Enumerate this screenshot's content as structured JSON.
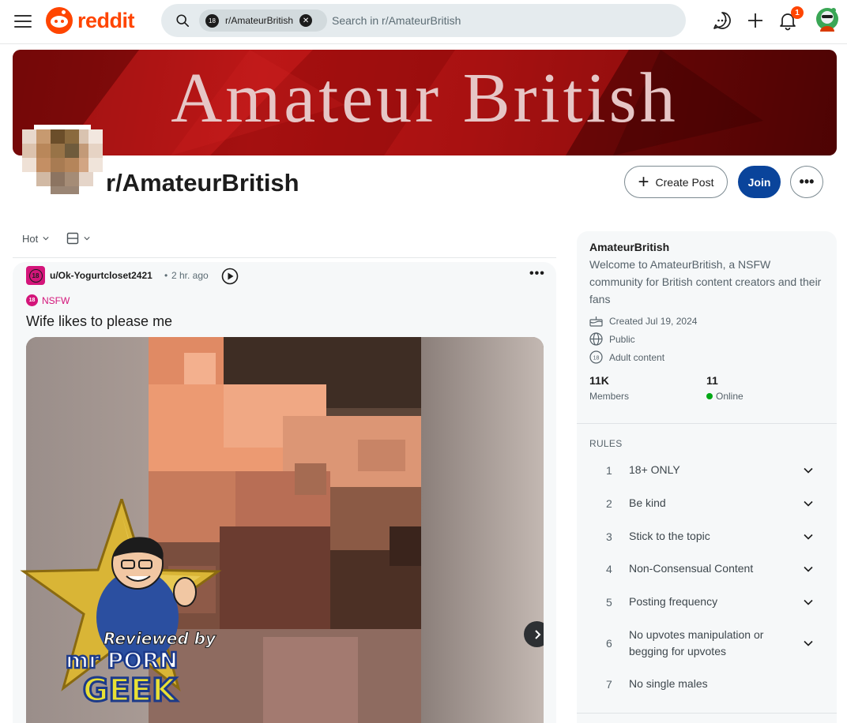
{
  "header": {
    "logo_text": "reddit",
    "search_chip": "r/AmateurBritish",
    "search_chip_badge": "18",
    "search_placeholder": "Search in r/AmateurBritish",
    "notification_count": "1"
  },
  "banner": {
    "title": "Amateur British"
  },
  "subreddit": {
    "name": "r/AmateurBritish",
    "create_post_label": "Create Post",
    "join_label": "Join",
    "more_label": "•••"
  },
  "feed": {
    "sort_label": "Hot",
    "post": {
      "avatar_badge": "18",
      "author": "u/Ok-Yogurtcloset2421",
      "separator": "•",
      "time": "2 hr. ago",
      "nsfw_badge": "18",
      "nsfw_label": "NSFW",
      "title": "Wife likes to please me",
      "menu_label": "•••"
    }
  },
  "sidebar": {
    "name": "AmateurBritish",
    "description": "Welcome to AmateurBritish, a NSFW community for British content creators and their fans",
    "created": "Created Jul 19, 2024",
    "visibility": "Public",
    "content_type": "Adult content",
    "members_value": "11K",
    "members_label": "Members",
    "online_value": "11",
    "online_label": "Online",
    "rules_heading": "RULES",
    "rules": [
      {
        "num": "1",
        "text": "18+ ONLY"
      },
      {
        "num": "2",
        "text": "Be kind"
      },
      {
        "num": "3",
        "text": "Stick to the topic"
      },
      {
        "num": "4",
        "text": "Non-Consensual Content"
      },
      {
        "num": "5",
        "text": "Posting frequency"
      },
      {
        "num": "6",
        "text": "No upvotes manipulation or begging for upvotes"
      },
      {
        "num": "7",
        "text": "No single males"
      }
    ]
  },
  "watermark": {
    "line1": "Reviewed by",
    "line2": "mr PORN",
    "line3": "GEEK"
  },
  "colors": {
    "brand": "#ff4500",
    "join_button": "#0a449b",
    "nsfw": "#d4157a",
    "online": "#01a816",
    "banner": "#a30f0f"
  }
}
